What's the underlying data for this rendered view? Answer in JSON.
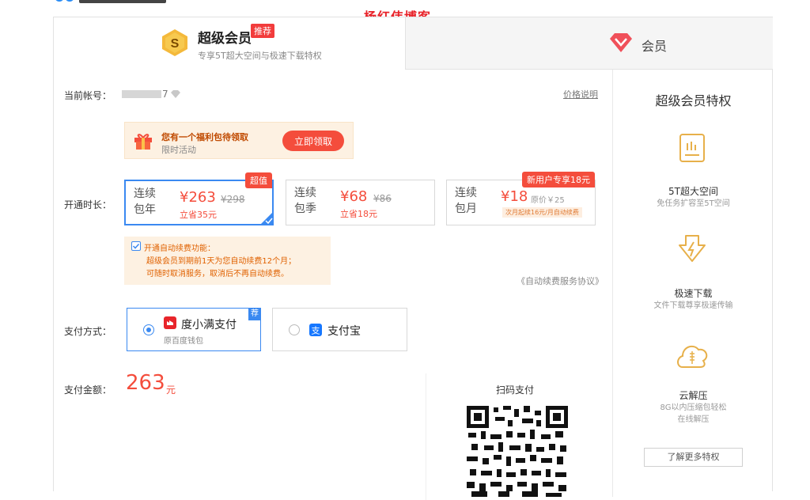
{
  "watermark": "杨红伟博客",
  "tabs": {
    "super": {
      "title": "超级会员",
      "badge": "推荐",
      "subtitle": "专享5T超大空间与极速下载特权"
    },
    "member": {
      "title": "会员"
    }
  },
  "account": {
    "label": "当前帐号：",
    "value": "7",
    "price_link": "价格说明"
  },
  "gift": {
    "title": "您有一个福利包待领取",
    "subtitle": "限时活动",
    "button": "立即领取"
  },
  "duration": {
    "label": "开通时长：",
    "plans": [
      {
        "name": "连续包年",
        "price": "¥263",
        "original": "¥298",
        "save": "立省35元",
        "tag": "超值",
        "selected": true
      },
      {
        "name": "连续包季",
        "price": "¥68",
        "original": "¥86",
        "save": "立省18元",
        "tag": "",
        "selected": false
      },
      {
        "name": "连续包月",
        "price": "¥18",
        "original": "原价￥25",
        "save": "次月起续16元/月自动续费",
        "tag": "新用户专享18元",
        "selected": false
      }
    ]
  },
  "auto_renew": {
    "title": "开通自动续费功能：",
    "line1": "超级会员到期前1天为您自动续费12个月；",
    "line2": "可随时取消服务，取消后不再自动续费。",
    "agreement": "《自动续费服务协议》"
  },
  "payment": {
    "label": "支付方式：",
    "options": [
      {
        "name": "度小满支付",
        "sub": "原百度钱包",
        "badge": "荐",
        "selected": true
      },
      {
        "name": "支付宝",
        "sub": "",
        "badge": "",
        "selected": false
      }
    ]
  },
  "amount": {
    "label": "支付金额：",
    "value": "263",
    "unit": "元"
  },
  "qr": {
    "title": "扫码支付"
  },
  "perks": {
    "title": "超级会员特权",
    "items": [
      {
        "name": "5T超大空间",
        "desc": "免任务扩容至5T空间",
        "icon": "storage-icon"
      },
      {
        "name": "极速下载",
        "desc": "文件下载尊享极速传输",
        "icon": "fast-download-icon"
      },
      {
        "name": "云解压",
        "desc": "8G以内压缩包轻松",
        "desc2": "在线解压",
        "icon": "cloud-unzip-icon"
      }
    ],
    "more": "了解更多特权"
  },
  "colors": {
    "accent_red": "#f44d3c",
    "accent_blue": "#3a89f1",
    "gold": "#e7b04a"
  }
}
